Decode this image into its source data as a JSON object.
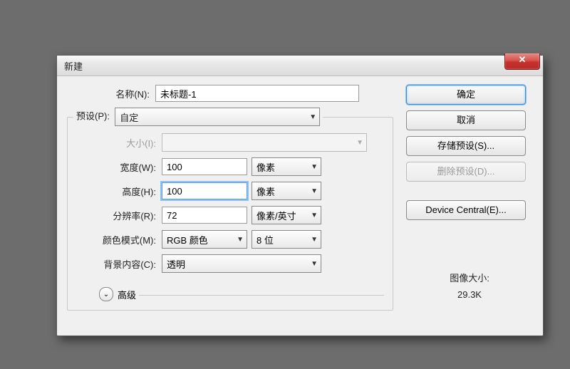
{
  "dialog": {
    "title": "新建",
    "close_glyph": "✕"
  },
  "labels": {
    "name": "名称(N):",
    "preset_legend": "预设(P):",
    "size": "大小(I):",
    "width": "宽度(W):",
    "height": "高度(H):",
    "resolution": "分辨率(R):",
    "color_mode": "颜色模式(M):",
    "background": "背景内容(C):",
    "advanced": "高级"
  },
  "values": {
    "name": "未标题-1",
    "preset": "自定",
    "size": "",
    "width": "100",
    "width_unit": "像素",
    "height": "100",
    "height_unit": "像素",
    "resolution": "72",
    "resolution_unit": "像素/英寸",
    "color_mode": "RGB 颜色",
    "color_depth": "8 位",
    "background": "透明"
  },
  "buttons": {
    "ok": "确定",
    "cancel": "取消",
    "save_preset": "存储预设(S)...",
    "delete_preset": "删除预设(D)...",
    "device_central": "Device Central(E)..."
  },
  "image_size": {
    "label": "图像大小:",
    "value": "29.3K"
  },
  "glyphs": {
    "dropdown": "▼",
    "expand": "⌄"
  }
}
